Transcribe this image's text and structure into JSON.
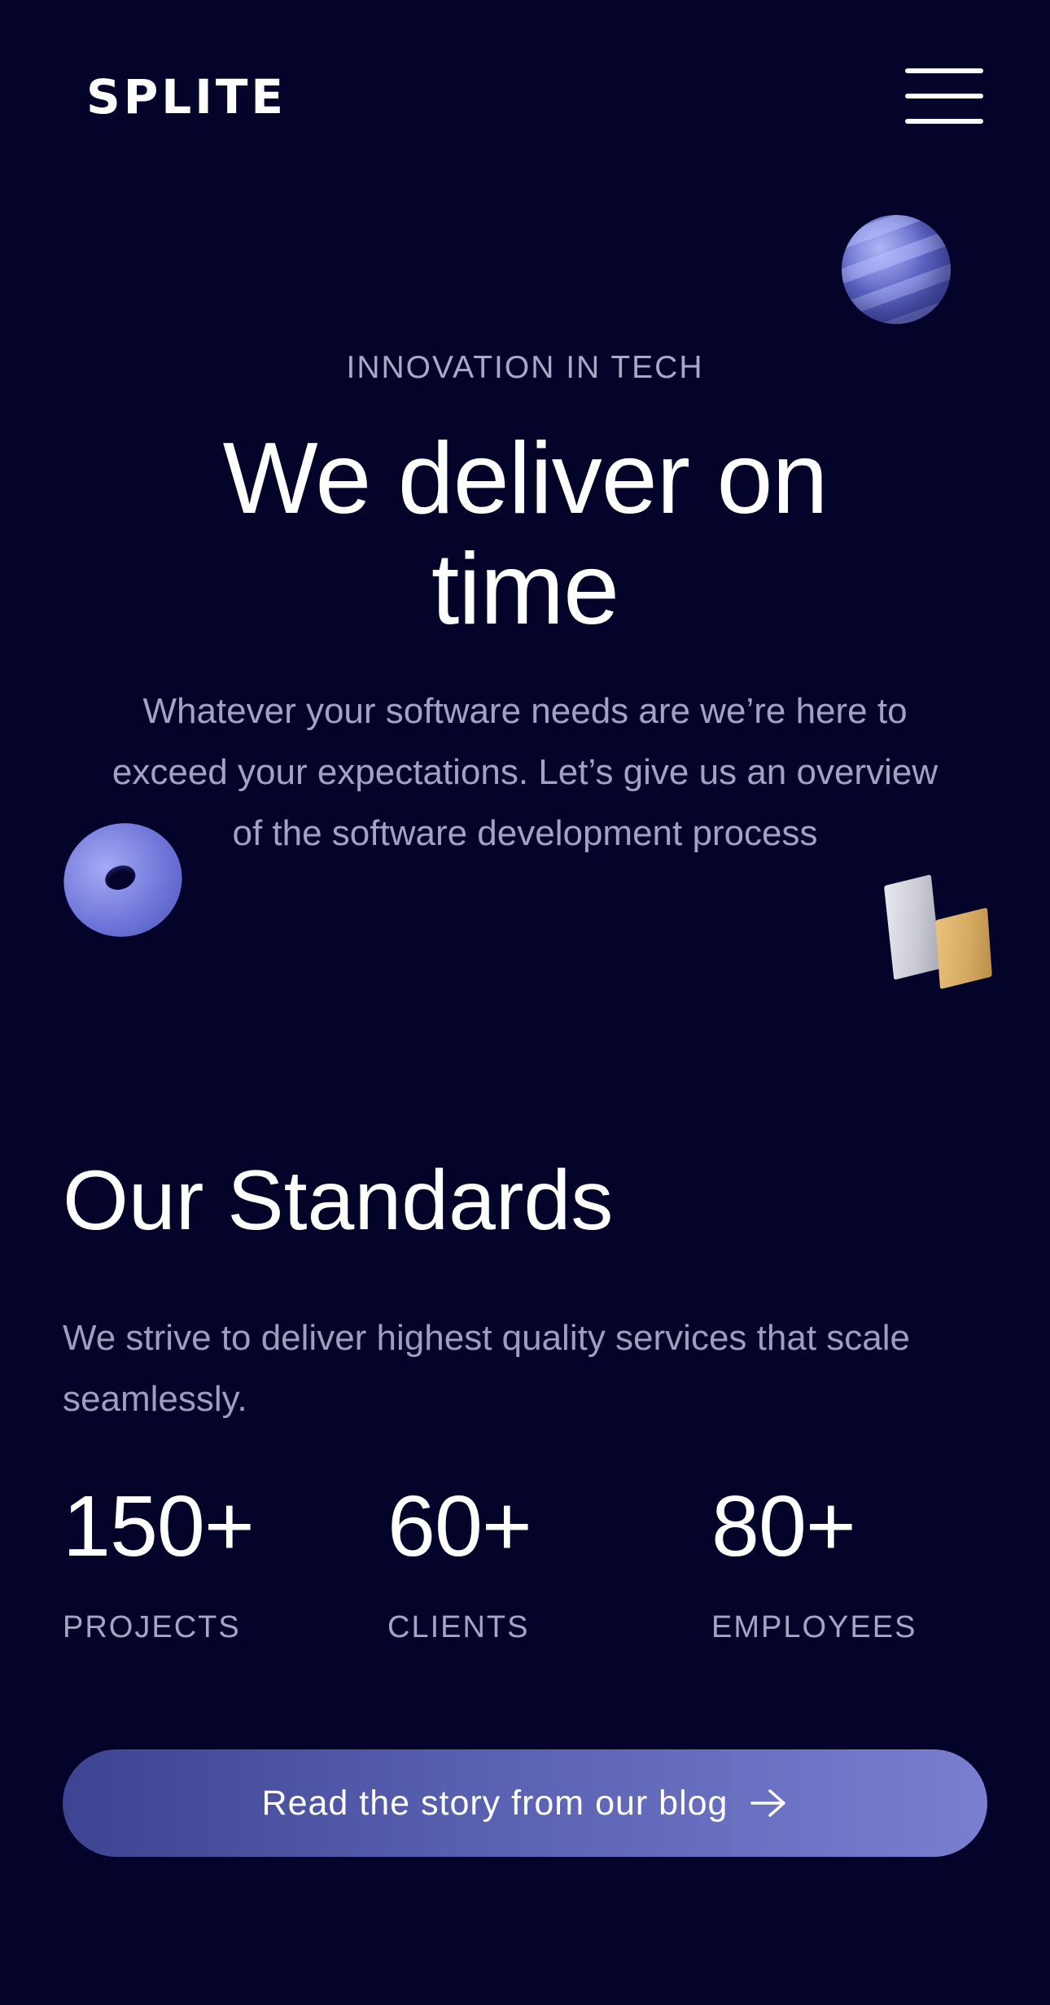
{
  "header": {
    "logo": "SPLITE"
  },
  "hero": {
    "kicker": "INNOVATION IN TECH",
    "title": "We deliver on time",
    "description": "Whatever your software needs are we’re here to exceed your expectations. Let’s give us an overview of the software development process"
  },
  "standards": {
    "title": "Our Standards",
    "description": "We strive to deliver highest quality services that scale seamlessly.",
    "stats": [
      {
        "value": "150+",
        "label": "PROJECTS"
      },
      {
        "value": "60+",
        "label": "CLIENTS"
      },
      {
        "value": "80+",
        "label": "EMPLOYEES"
      }
    ]
  },
  "cta": {
    "label": "Read the story from our blog",
    "icon": "arrow-right-icon"
  },
  "icons": {
    "menu": "hamburger-menu-icon",
    "decorations": [
      "striped-sphere",
      "torus",
      "cubes"
    ]
  },
  "colors": {
    "background": "#04032a",
    "text": "#ffffff",
    "muted": "#a3a2c2",
    "accent_start": "#3d4592",
    "accent_end": "#7a7fd0"
  }
}
